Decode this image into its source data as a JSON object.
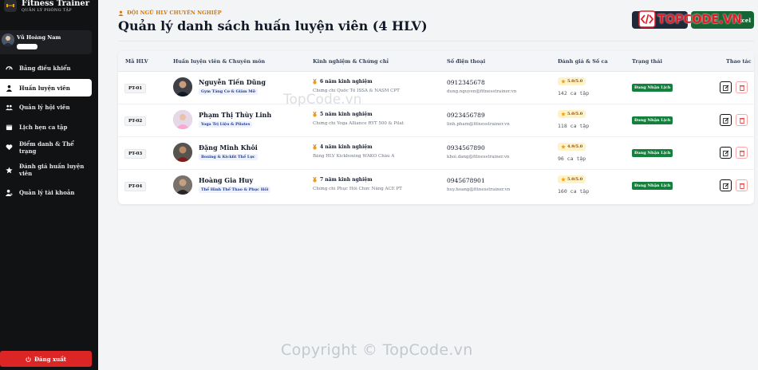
{
  "brand": {
    "name": "Fitness Trainer",
    "subtitle": "QUẢN LÝ PHÒNG TẬP"
  },
  "user": {
    "name": "Vũ Hoàng Nam"
  },
  "sidebar": {
    "items": [
      {
        "label": "Bảng điều khiển",
        "icon": "dashboard-icon",
        "active": false
      },
      {
        "label": "Huấn luyện viên",
        "icon": "trainer-icon",
        "active": true
      },
      {
        "label": "Quản lý hội viên",
        "icon": "members-icon",
        "active": false
      },
      {
        "label": "Lịch hẹn ca tập",
        "icon": "calendar-icon",
        "active": false
      },
      {
        "label": "Điểm danh & Thể trạng",
        "icon": "heartbeat-icon",
        "active": false
      },
      {
        "label": "Đánh giá huấn luyện viên",
        "icon": "star-icon",
        "active": false
      },
      {
        "label": "Quản lý tài khoản",
        "icon": "user-gear-icon",
        "active": false
      }
    ],
    "logout": "Đăng xuất"
  },
  "header": {
    "eyebrow": "ĐỘI NGŨ HLV CHUYÊN NGHIỆP",
    "title": "Quản lý danh sách huấn luyện viên (4 HLV)",
    "export_label": "xcel",
    "logo_text": "TOPCODE.VN"
  },
  "table": {
    "headers": [
      "Mã HLV",
      "Huấn luyện viên & Chuyên môn",
      "Kinh nghiệm & Chứng chỉ",
      "Số điện thoại",
      "Đánh giá & Số ca",
      "Trạng thái",
      "Thao tác"
    ],
    "rows": [
      {
        "code": "PT-01",
        "name": "Nguyễn Tiến Dũng",
        "specialty": "Gym Tăng Cơ & Giảm Mỡ",
        "experience": "6 năm kinh nghiệm",
        "certificate": "Chứng chỉ Quốc Tế ISSA & NASM CPT",
        "phone": "0912345678",
        "email": "dung.nguyen@fitnesstrainer.vn",
        "rating": "5.0/5.0",
        "sessions": "142 ca tập",
        "status": "Đang Nhận Lịch"
      },
      {
        "code": "PT-02",
        "name": "Phạm Thị Thùy Linh",
        "specialty": "Yoga Trị Liệu & Pilates",
        "experience": "5 năm kinh nghiệm",
        "certificate": "Chứng chỉ Yoga Alliance RYT 500 & Pilat...",
        "phone": "0923456789",
        "email": "linh.pham@fitnesstrainer.vn",
        "rating": "5.0/5.0",
        "sessions": "118 ca tập",
        "status": "Đang Nhận Lịch"
      },
      {
        "code": "PT-03",
        "name": "Đặng Minh Khôi",
        "specialty": "Boxing & Kickfit Thể Lực",
        "experience": "4 năm kinh nghiệm",
        "certificate": "Bằng HLV Kickboxing WAKO Châu Á",
        "phone": "0934567890",
        "email": "khoi.dang@fitnesstrainer.vn",
        "rating": "4.9/5.0",
        "sessions": "96 ca tập",
        "status": "Đang Nhận Lịch"
      },
      {
        "code": "PT-04",
        "name": "Hoàng Gia Huy",
        "specialty": "Thể Hình Thể Thao & Phục Hồi",
        "experience": "7 năm kinh nghiệm",
        "certificate": "Chứng chỉ Phục Hồi Chức Năng ACE PT",
        "phone": "0945678901",
        "email": "huy.hoang@fitnesstrainer.vn",
        "rating": "5.0/5.0",
        "sessions": "160 ca tập",
        "status": "Đang Nhận Lịch"
      }
    ]
  },
  "watermark": {
    "bottom": "Copyright © TopCode.vn",
    "middle": "TopCode.vn"
  },
  "colors": {
    "accent": "#d97706",
    "status": "#15803d",
    "danger": "#dc2626",
    "sidebar": "#111214"
  }
}
